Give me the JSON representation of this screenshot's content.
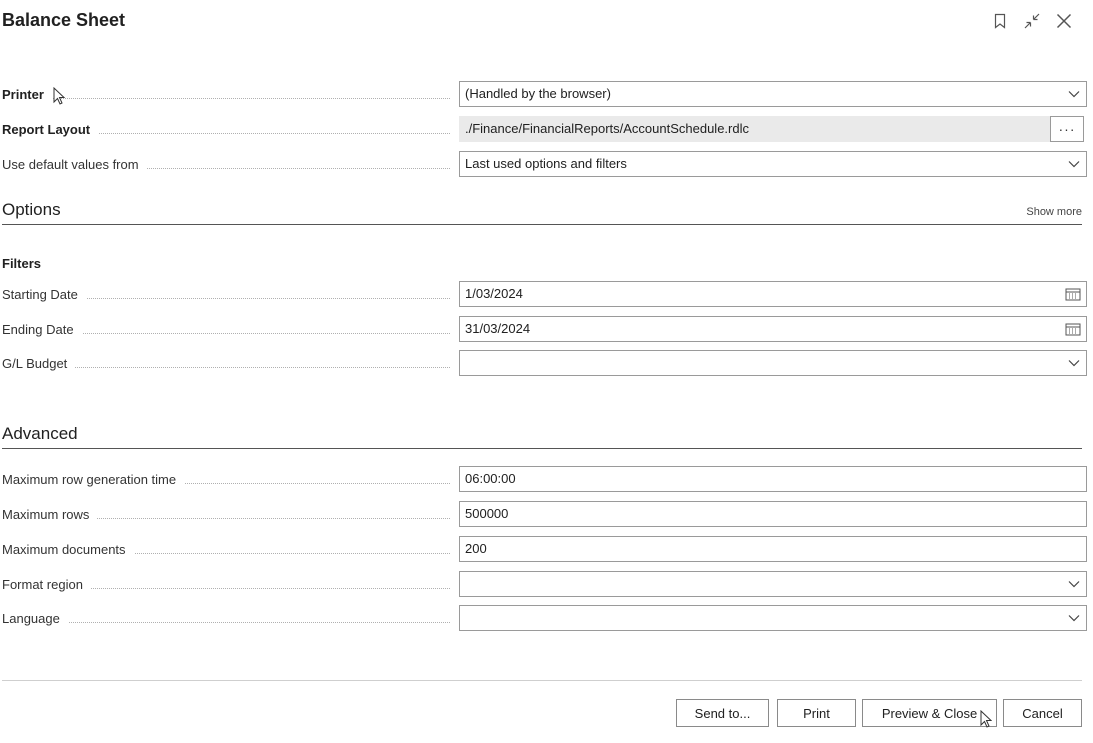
{
  "dialog": {
    "title": "Balance Sheet"
  },
  "header_icons": [
    "bookmark-icon",
    "collapse-icon",
    "close-icon"
  ],
  "request": {
    "printer": {
      "label": "Printer",
      "value": "(Handled by the browser)"
    },
    "report_layout": {
      "label": "Report Layout",
      "value": "./Finance/FinancialReports/AccountSchedule.rdlc",
      "button": "···"
    },
    "defaults": {
      "label": "Use default values from",
      "value": "Last used options and filters"
    }
  },
  "options": {
    "heading": "Options",
    "show_more": "Show more"
  },
  "filters": {
    "heading": "Filters",
    "starting_date": {
      "label": "Starting Date",
      "value": "1/03/2024"
    },
    "ending_date": {
      "label": "Ending Date",
      "value": "31/03/2024"
    },
    "gl_budget": {
      "label": "G/L Budget",
      "value": ""
    }
  },
  "advanced": {
    "heading": "Advanced",
    "max_row_time": {
      "label": "Maximum row generation time",
      "value": "06:00:00"
    },
    "max_rows": {
      "label": "Maximum rows",
      "value": "500000"
    },
    "max_documents": {
      "label": "Maximum documents",
      "value": "200"
    },
    "format_region": {
      "label": "Format region",
      "value": ""
    },
    "language": {
      "label": "Language",
      "value": ""
    }
  },
  "footer": {
    "send_to": "Send to...",
    "print": "Print",
    "preview_close": "Preview & Close",
    "cancel": "Cancel"
  },
  "colors": {
    "border": "#9a9a9a",
    "readonly_bg": "#eaeaea",
    "section_rule": "#555555"
  }
}
